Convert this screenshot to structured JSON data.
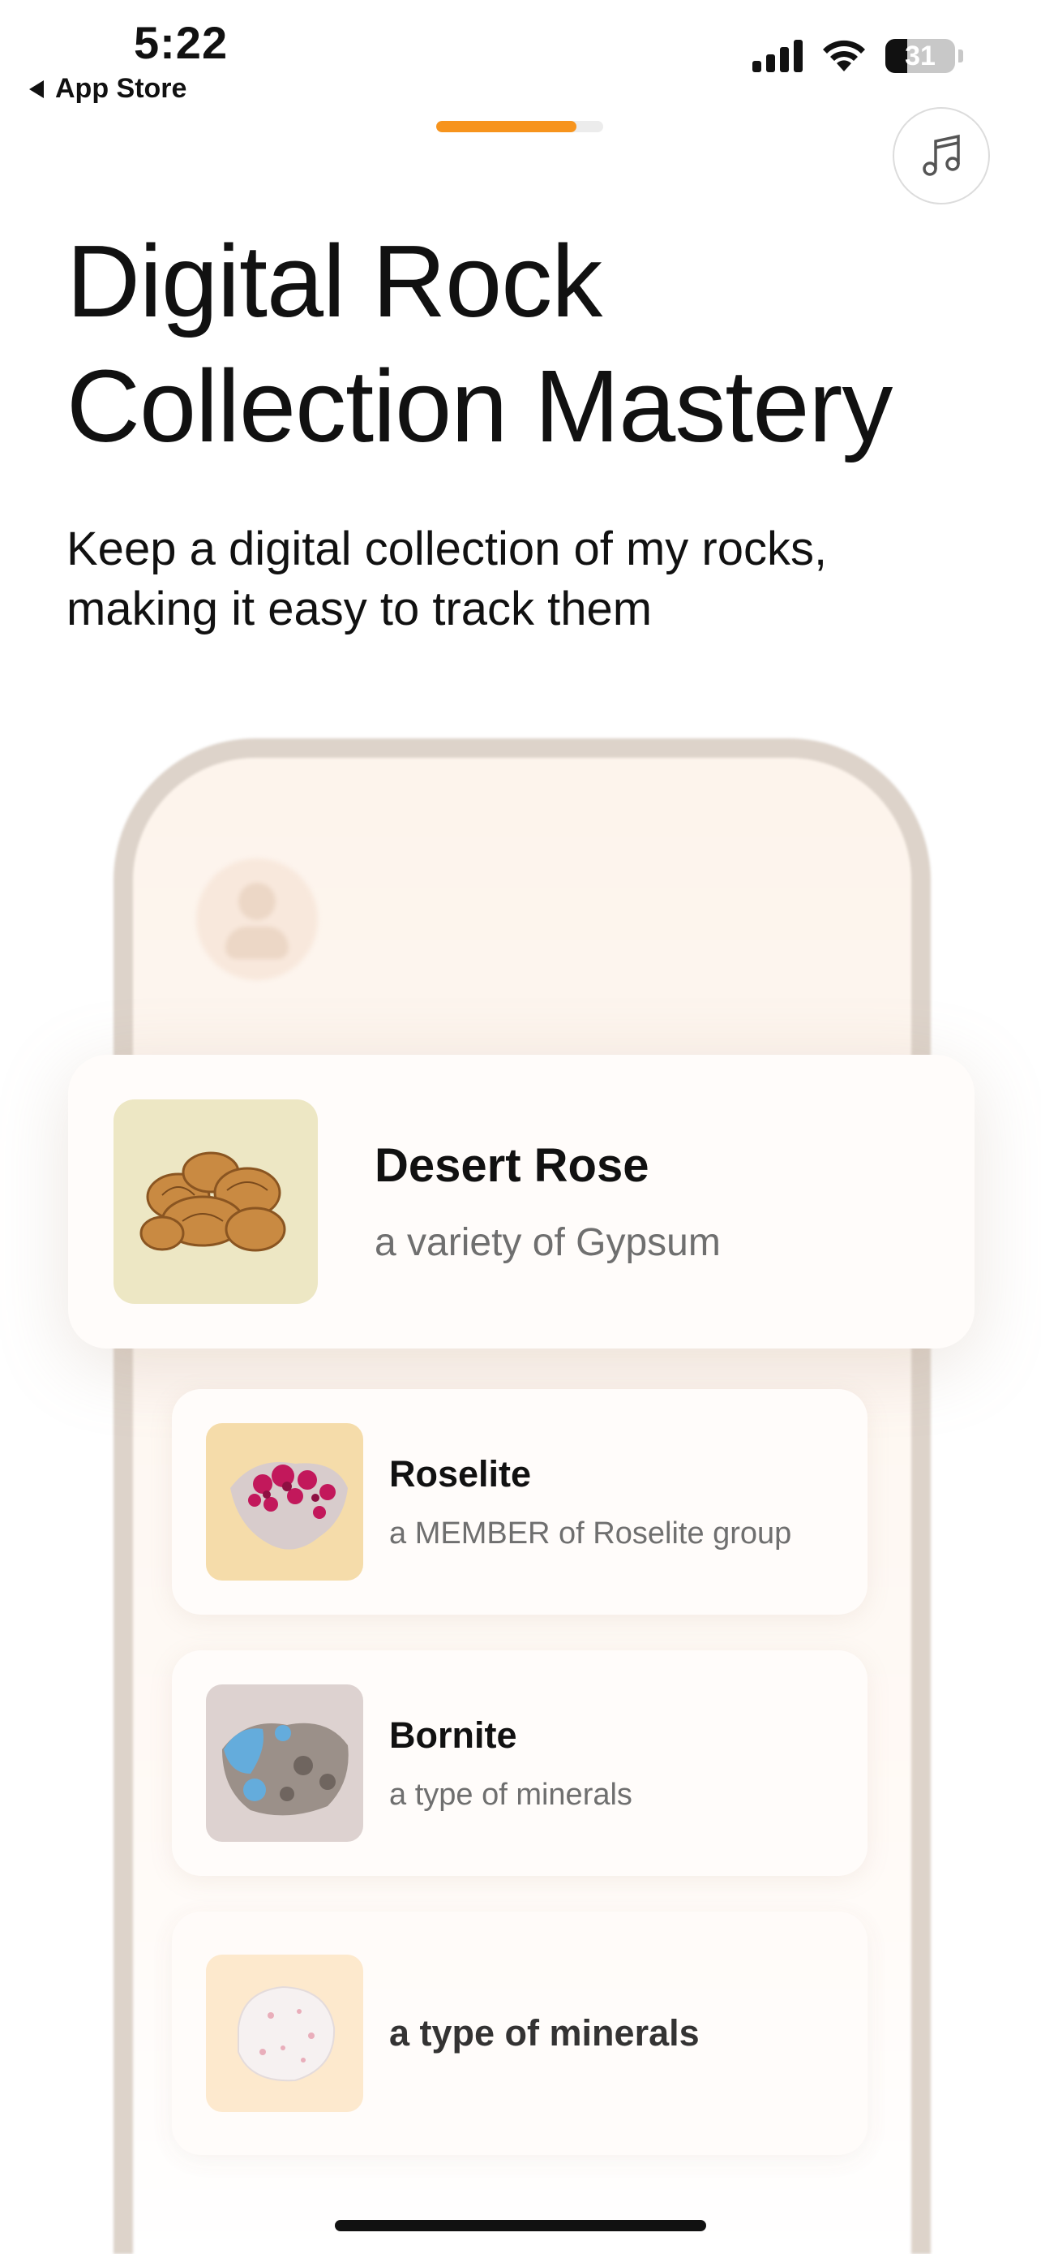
{
  "status_bar": {
    "time": "5:22",
    "back_label": "App Store",
    "battery": "31",
    "battery_level": 0.31,
    "icons": [
      "signal-icon",
      "wifi-icon",
      "battery-icon"
    ]
  },
  "progress": {
    "fraction": 0.84,
    "color": "#f7941d"
  },
  "music_button": {
    "icon": "music-note-icon"
  },
  "headline": "Digital Rock Collection Mastery",
  "subtitle": "Keep a digital collection of my rocks, making it easy to track them",
  "featured_card": {
    "title": "Desert Rose",
    "subtitle": "a variety of Gypsum",
    "thumb_bg": "#ede7c4"
  },
  "list": [
    {
      "title": "Roselite",
      "subtitle": "a MEMBER of Roselite group",
      "thumb_bg": "#f5dcaa"
    },
    {
      "title": "Bornite",
      "subtitle": "a type of minerals",
      "thumb_bg": "#ddd2d0"
    },
    {
      "title": "a type of minerals",
      "subtitle": "",
      "thumb_bg": "#fde6c6"
    }
  ]
}
